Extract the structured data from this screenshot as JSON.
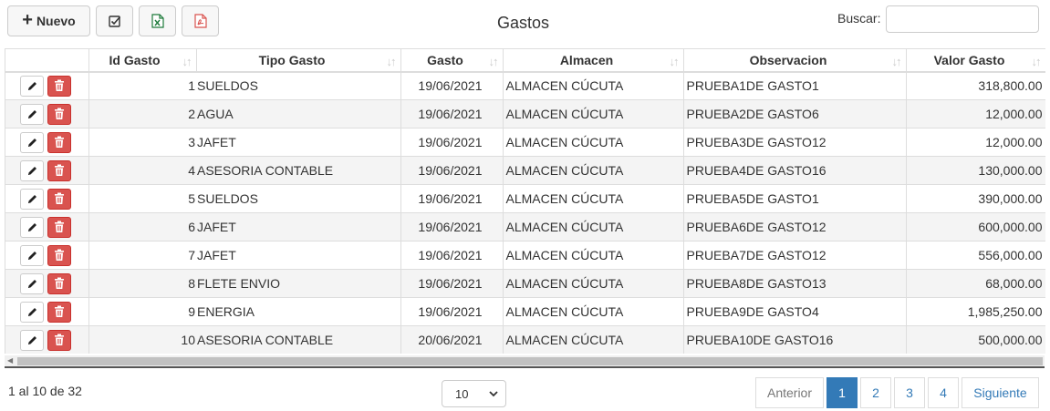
{
  "toolbar": {
    "nuevo_label": "Nuevo",
    "buttons": [
      {
        "icon": "check-square-icon"
      },
      {
        "icon": "excel-file-icon",
        "color": "#1d7a3a"
      },
      {
        "icon": "pdf-file-icon",
        "color": "#d9534f"
      }
    ]
  },
  "page": {
    "title": "Gastos"
  },
  "search": {
    "label": "Buscar:",
    "value": ""
  },
  "table": {
    "columns": [
      "Id Gasto",
      "Tipo Gasto",
      "Gasto",
      "Almacen",
      "Observacion",
      "Valor Gasto"
    ],
    "rows": [
      {
        "id": "1",
        "tipo": "SUELDOS",
        "fecha": "19/06/2021",
        "almacen": "ALMACEN CÚCUTA",
        "obs": "PRUEBA1DE GASTO1",
        "valor": "318,800.00"
      },
      {
        "id": "2",
        "tipo": "AGUA",
        "fecha": "19/06/2021",
        "almacen": "ALMACEN CÚCUTA",
        "obs": "PRUEBA2DE GASTO6",
        "valor": "12,000.00"
      },
      {
        "id": "3",
        "tipo": "JAFET",
        "fecha": "19/06/2021",
        "almacen": "ALMACEN CÚCUTA",
        "obs": "PRUEBA3DE GASTO12",
        "valor": "12,000.00"
      },
      {
        "id": "4",
        "tipo": "ASESORIA CONTABLE",
        "fecha": "19/06/2021",
        "almacen": "ALMACEN CÚCUTA",
        "obs": "PRUEBA4DE GASTO16",
        "valor": "130,000.00"
      },
      {
        "id": "5",
        "tipo": "SUELDOS",
        "fecha": "19/06/2021",
        "almacen": "ALMACEN CÚCUTA",
        "obs": "PRUEBA5DE GASTO1",
        "valor": "390,000.00"
      },
      {
        "id": "6",
        "tipo": "JAFET",
        "fecha": "19/06/2021",
        "almacen": "ALMACEN CÚCUTA",
        "obs": "PRUEBA6DE GASTO12",
        "valor": "600,000.00"
      },
      {
        "id": "7",
        "tipo": "JAFET",
        "fecha": "19/06/2021",
        "almacen": "ALMACEN CÚCUTA",
        "obs": "PRUEBA7DE GASTO12",
        "valor": "556,000.00"
      },
      {
        "id": "8",
        "tipo": "FLETE ENVIO",
        "fecha": "19/06/2021",
        "almacen": "ALMACEN CÚCUTA",
        "obs": "PRUEBA8DE GASTO13",
        "valor": "68,000.00"
      },
      {
        "id": "9",
        "tipo": "ENERGIA",
        "fecha": "19/06/2021",
        "almacen": "ALMACEN CÚCUTA",
        "obs": "PRUEBA9DE GASTO4",
        "valor": "1,985,250.00"
      },
      {
        "id": "10",
        "tipo": "ASESORIA CONTABLE",
        "fecha": "20/06/2021",
        "almacen": "ALMACEN CÚCUTA",
        "obs": "PRUEBA10DE GASTO16",
        "valor": "500,000.00"
      }
    ]
  },
  "footer": {
    "info": "1 al 10 de 32",
    "page_size": "10",
    "pagination": {
      "prev": "Anterior",
      "pages": [
        "1",
        "2",
        "3",
        "4"
      ],
      "active": "1",
      "next": "Siguiente"
    }
  },
  "colors": {
    "primary": "#337ab7",
    "danger": "#d9534f",
    "excel": "#1d7a3a"
  }
}
